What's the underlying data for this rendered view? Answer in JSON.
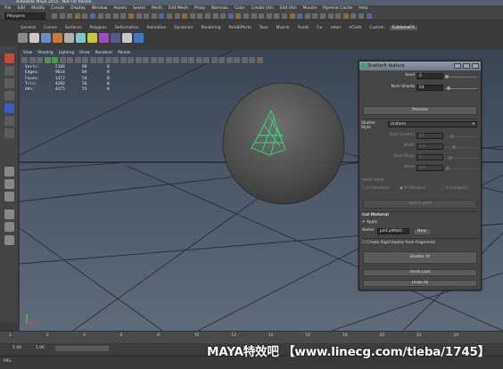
{
  "window": {
    "title": "Autodesk Maya 2015 - Not For Resale"
  },
  "menubar": [
    "File",
    "Edit",
    "Modify",
    "Create",
    "Display",
    "Window",
    "Assets",
    "Select",
    "Mesh",
    "Edit Mesh",
    "Proxy",
    "Normals",
    "Color",
    "Create UVs",
    "Edit UVs",
    "Muscle",
    "Pipeline Cache",
    "Help"
  ],
  "statusline": {
    "mode": "Polygons"
  },
  "shelf": {
    "tabs": [
      "General",
      "Curves",
      "Surfaces",
      "Polygons",
      "Deformation",
      "Animation",
      "Dynamics",
      "Rendering",
      "PaintEffects",
      "Toon",
      "Muscle",
      "Fluids",
      "Fur",
      "nHair",
      "nCloth",
      "Custom",
      "FulldomeFX"
    ],
    "active_tab": "FulldomeFX"
  },
  "viewport": {
    "menu": [
      "View",
      "Shading",
      "Lighting",
      "Show",
      "Renderer",
      "Panels"
    ],
    "hud": [
      {
        "label": "Verts:",
        "v1": "5184",
        "v2": "88",
        "v3": "0"
      },
      {
        "label": "Edges:",
        "v1": "9614",
        "v2": "84",
        "v3": "0"
      },
      {
        "label": "Faces:",
        "v1": "1472",
        "v2": "54",
        "v3": "0"
      },
      {
        "label": "Tris:",
        "v1": "4292",
        "v2": "56",
        "v3": "0"
      },
      {
        "label": "UVs:",
        "v1": "4375",
        "v2": "55",
        "v3": "0"
      }
    ]
  },
  "shatter_window": {
    "title": "ShatterIt feature",
    "seed_label": "Seed",
    "seed_value": "0",
    "num_shards_label": "Num Shards",
    "num_shards_value": "64",
    "preview_label": "Preview",
    "shatter_style_label": "Shatter Style",
    "shatter_style_value": "Uniform",
    "num_centers_label": "Num Centers",
    "num_centers_value": "10",
    "width_label": "Width",
    "width_value": "1.0",
    "num_rings_label": "Num Rings",
    "num_rings_value": "3",
    "noise_label": "Noise",
    "noise_value": "0.0",
    "mode_label": "Mode Mode",
    "modes": [
      "0 [Shortest]",
      "M [Median]",
      "0 [Longest]"
    ],
    "select_path_label": "Select path",
    "cut_material_label": "Cut Material",
    "apply_label": "Apply",
    "name_label": "Name",
    "name_value": "pdiCutMat0",
    "new_label": "New",
    "rigid_label": "Create Rigid bodies from fragments",
    "shatter_button": "Shatter It!",
    "undo_last": "Undo Last",
    "undo_all": "Undo All"
  },
  "timeline": {
    "ticks": [
      "1",
      "2",
      "4",
      "6",
      "8",
      "10",
      "12",
      "14",
      "16",
      "18",
      "20",
      "22",
      "24"
    ],
    "start": "1.00",
    "end": "1.00"
  },
  "command_line": {
    "label": "MEL"
  },
  "watermark": "MAYA特效吧 【www.linecg.com/tieba/1745】"
}
